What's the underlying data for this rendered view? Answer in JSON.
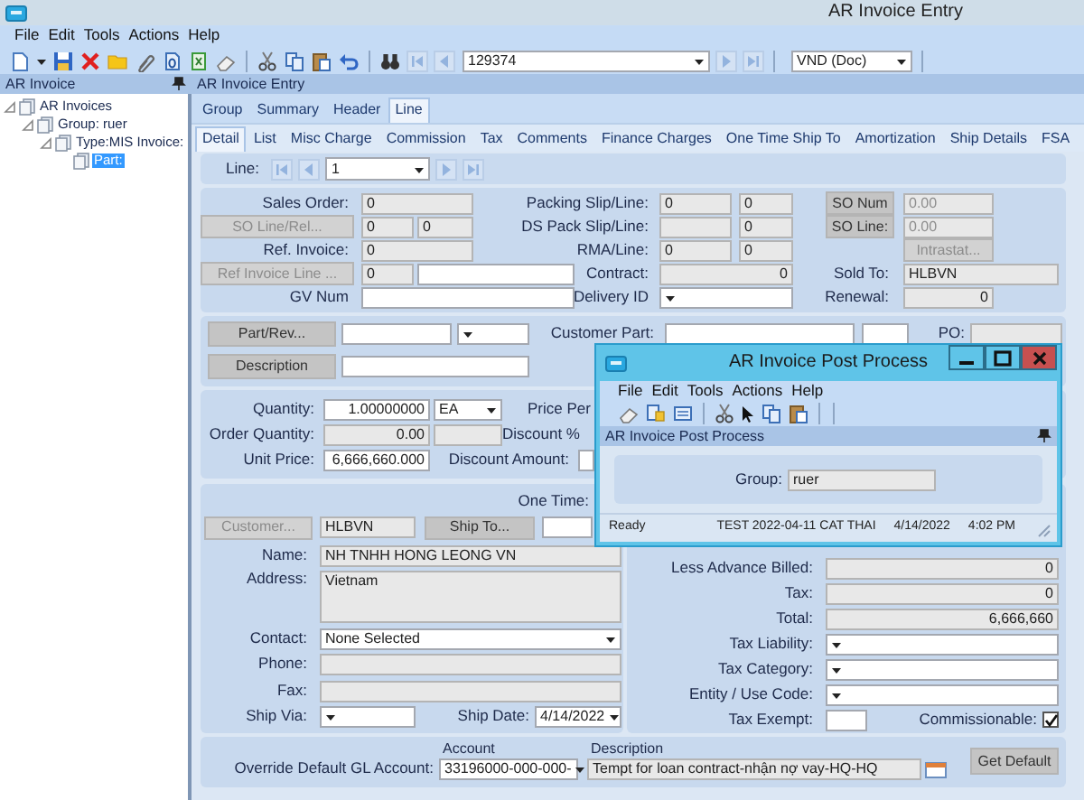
{
  "window": {
    "title": "AR Invoice Entry"
  },
  "menu": [
    "File",
    "Edit",
    "Tools",
    "Actions",
    "Help"
  ],
  "toolbar": {
    "record": "129374",
    "currency": "VND (Doc)"
  },
  "navigator": {
    "title": "AR Invoice",
    "tree": [
      {
        "label": "AR Invoices",
        "expanded": true,
        "selected": false,
        "children": [
          {
            "label": "Group: ruer",
            "expanded": true,
            "selected": false,
            "children": [
              {
                "label": "Type:MIS Invoice:",
                "expanded": true,
                "selected": false,
                "children": [
                  {
                    "label": "Part:",
                    "selected": true
                  }
                ]
              }
            ]
          }
        ]
      }
    ]
  },
  "entry_title": "AR Invoice Entry",
  "tabs": [
    {
      "label": "Group",
      "selected": false
    },
    {
      "label": "Summary",
      "selected": false
    },
    {
      "label": "Header",
      "selected": false
    },
    {
      "label": "Line",
      "selected": true
    }
  ],
  "subtabs": [
    {
      "label": "Detail",
      "selected": true
    },
    {
      "label": "List",
      "selected": false
    },
    {
      "label": "Misc Charge",
      "selected": false
    },
    {
      "label": "Commission",
      "selected": false
    },
    {
      "label": "Tax",
      "selected": false
    },
    {
      "label": "Comments",
      "selected": false
    },
    {
      "label": "Finance Charges",
      "selected": false
    },
    {
      "label": "One Time Ship To",
      "selected": false
    },
    {
      "label": "Amortization",
      "selected": false
    },
    {
      "label": "Ship Details",
      "selected": false
    },
    {
      "label": "FSA",
      "selected": false
    }
  ],
  "line_nav": {
    "label": "Line:",
    "value": "1"
  },
  "line_detail": [
    {
      "kind": "label",
      "text": "Sales Order:"
    },
    {
      "kind": "display",
      "value": "0"
    },
    {
      "kind": "label",
      "text": "Packing Slip/Line:"
    },
    {
      "kind": "display",
      "value": "0"
    },
    {
      "kind": "display",
      "value": "0"
    },
    {
      "kind": "button",
      "text": "SO Num",
      "disabled": false
    },
    {
      "kind": "inactive",
      "value": "0.00"
    },
    {
      "kind": "button",
      "text": "SO Line/Rel...",
      "disabled": true
    },
    {
      "kind": "display",
      "value": "0"
    },
    {
      "kind": "display",
      "value": "0"
    },
    {
      "kind": "label",
      "text": "DS Pack Slip/Line:"
    },
    {
      "kind": "display"
    },
    {
      "kind": "display",
      "value": "0"
    },
    {
      "kind": "button",
      "text": "SO Line:",
      "disabled": false
    },
    {
      "kind": "inactive",
      "value": "0.00"
    },
    {
      "kind": "label",
      "text": "Ref. Invoice:"
    },
    {
      "kind": "display",
      "value": "0"
    },
    {
      "kind": "label",
      "text": "RMA/Line:"
    },
    {
      "kind": "display",
      "value": "0"
    },
    {
      "kind": "display",
      "value": "0"
    },
    {
      "kind": "button",
      "text": "Intrastat...",
      "disabled": true
    },
    {
      "kind": "button",
      "text": "Ref Invoice Line ...",
      "disabled": true
    },
    {
      "kind": "display",
      "value": "0"
    },
    {
      "kind": "input"
    },
    {
      "kind": "label",
      "text": "Contract:"
    },
    {
      "kind": "number",
      "value": "0"
    },
    {
      "kind": "label",
      "text": "Sold To:"
    },
    {
      "kind": "display",
      "value": "HLBVN"
    },
    {
      "kind": "label",
      "text": "GV Num"
    },
    {
      "kind": "input"
    },
    {
      "kind": "label",
      "text": "Delivery ID"
    },
    {
      "kind": "combo"
    },
    {
      "kind": "label",
      "text": "Renewal:"
    },
    {
      "kind": "number",
      "value": "0"
    }
  ],
  "part": [
    {
      "kind": "button",
      "text": "Part/Rev...",
      "disabled": false
    },
    {
      "kind": "input"
    },
    {
      "kind": "combo"
    },
    {
      "kind": "label",
      "text": "Customer Part:"
    },
    {
      "kind": "input"
    },
    {
      "kind": "input"
    },
    {
      "kind": "label",
      "text": "PO:"
    },
    {
      "kind": "display"
    },
    {
      "kind": "button",
      "text": "Description",
      "disabled": false
    },
    {
      "kind": "input"
    }
  ],
  "quantities": [
    {
      "kind": "label",
      "text": "Quantity:"
    },
    {
      "kind": "input_num",
      "value": "1.00000000"
    },
    {
      "kind": "combo",
      "value": "EA"
    },
    {
      "kind": "label",
      "text": "Price Per"
    },
    {
      "kind": "label",
      "text": "Order Quantity:"
    },
    {
      "kind": "number",
      "value": "0.00"
    },
    {
      "kind": "display"
    },
    {
      "kind": "label",
      "text": "Discount %"
    },
    {
      "kind": "label",
      "text": "Unit Price:"
    },
    {
      "kind": "input_num",
      "value": "6,666,660.000"
    },
    {
      "kind": "label",
      "text": "Discount Amount:"
    },
    {
      "kind": "input"
    }
  ],
  "ship_to": [
    {
      "kind": "label",
      "text": "One Time:"
    },
    {
      "kind": "button",
      "text": "Customer...",
      "disabled": true
    },
    {
      "kind": "display",
      "value": "HLBVN"
    },
    {
      "kind": "button",
      "text": "Ship To...",
      "disabled": false
    },
    {
      "kind": "input"
    },
    {
      "kind": "label",
      "text": "Name:"
    },
    {
      "kind": "display",
      "value": "NH TNHH HONG LEONG VN"
    },
    {
      "kind": "label",
      "text": "Address:"
    },
    {
      "kind": "textarea",
      "value": "Vietnam"
    },
    {
      "kind": "label",
      "text": "Contact:"
    },
    {
      "kind": "combo",
      "value": "None Selected"
    },
    {
      "kind": "label",
      "text": "Phone:"
    },
    {
      "kind": "display"
    },
    {
      "kind": "label",
      "text": "Fax:"
    },
    {
      "kind": "display"
    },
    {
      "kind": "label",
      "text": "Ship Via:"
    },
    {
      "kind": "combo"
    },
    {
      "kind": "label",
      "text": "Ship Date:"
    },
    {
      "kind": "combo",
      "value": "4/14/2022"
    }
  ],
  "totals": [
    {
      "kind": "label",
      "text": "Less Advance Billed:"
    },
    {
      "kind": "number",
      "value": "0"
    },
    {
      "kind": "label",
      "text": "Tax:"
    },
    {
      "kind": "number",
      "value": "0"
    },
    {
      "kind": "label",
      "text": "Total:"
    },
    {
      "kind": "number",
      "value": "6,666,660"
    },
    {
      "kind": "label",
      "text": "Tax Liability:"
    },
    {
      "kind": "combo"
    },
    {
      "kind": "label",
      "text": "Tax Category:"
    },
    {
      "kind": "combo"
    },
    {
      "kind": "label",
      "text": "Entity / Use Code:"
    },
    {
      "kind": "combo"
    },
    {
      "kind": "label",
      "text": "Tax Exempt:"
    },
    {
      "kind": "input"
    },
    {
      "kind": "label",
      "text": "Commissionable:"
    },
    {
      "kind": "check",
      "checked": true
    }
  ],
  "gl_account": [
    {
      "kind": "heading",
      "text": "Account"
    },
    {
      "kind": "heading",
      "text": "Description"
    },
    {
      "kind": "label",
      "text": "Override Default GL Account:"
    },
    {
      "kind": "combo",
      "value": "33196000-000-000-"
    },
    {
      "kind": "display",
      "value": "Tempt for loan contract-nhận nợ vay-HQ-HQ"
    },
    {
      "kind": "button",
      "text": "Get Default",
      "disabled": false
    }
  ],
  "dialog": {
    "title": "AR Invoice Post Process",
    "menu": [
      "File",
      "Edit",
      "Tools",
      "Actions",
      "Help"
    ],
    "panel_title": "AR Invoice Post Process",
    "group_label": "Group:",
    "group_value": "ruer",
    "status": [
      "Ready",
      "TEST 2022-04-11 CAT THAI",
      "4/14/2022",
      "4:02 PM"
    ]
  }
}
